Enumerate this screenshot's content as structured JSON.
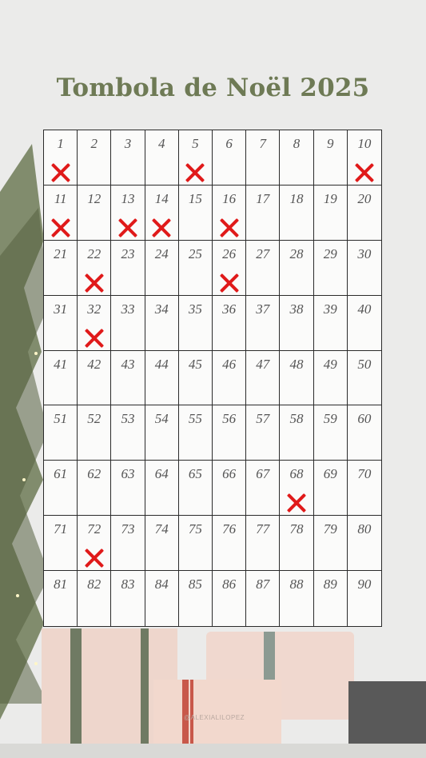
{
  "title": "Tombola de Noël 2025",
  "grid": {
    "numbers": [
      1,
      2,
      3,
      4,
      5,
      6,
      7,
      8,
      9,
      10,
      11,
      12,
      13,
      14,
      15,
      16,
      17,
      18,
      19,
      20,
      21,
      22,
      23,
      24,
      25,
      26,
      27,
      28,
      29,
      30,
      31,
      32,
      33,
      34,
      35,
      36,
      37,
      38,
      39,
      40,
      41,
      42,
      43,
      44,
      45,
      46,
      47,
      48,
      49,
      50,
      51,
      52,
      53,
      54,
      55,
      56,
      57,
      58,
      59,
      60,
      61,
      62,
      63,
      64,
      65,
      66,
      67,
      68,
      69,
      70,
      71,
      72,
      73,
      74,
      75,
      76,
      77,
      78,
      79,
      80,
      81,
      82,
      83,
      84,
      85,
      86,
      87,
      88,
      89,
      90
    ],
    "marked": [
      1,
      5,
      10,
      11,
      13,
      14,
      16,
      22,
      26,
      32,
      68,
      72
    ],
    "mark_color": "#e01a1a"
  },
  "credit": "@ALEXIALILOPEZ",
  "colors": {
    "title": "#6e7a55",
    "background": "#ebebea",
    "tree": "#6f7b57"
  }
}
